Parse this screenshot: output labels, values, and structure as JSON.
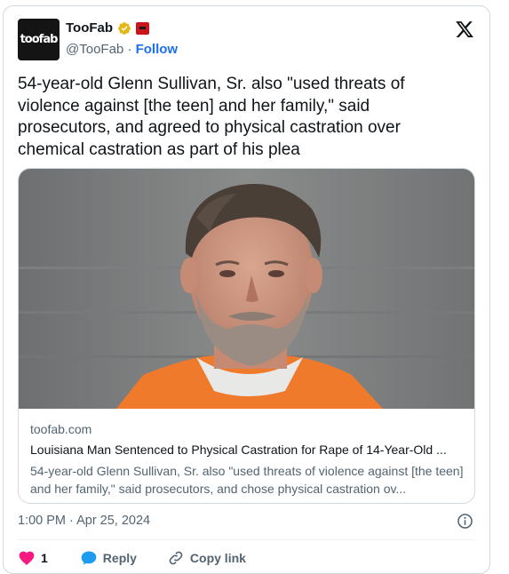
{
  "author": {
    "avatar_text": "toofab",
    "name": "TooFab",
    "handle": "@TooFab",
    "separator": "·",
    "follow_label": "Follow"
  },
  "tweet": {
    "text": "54-year-old Glenn Sullivan, Sr. also \"used threats of violence against [the teen] and her family,\" said prosecutors, and agreed to physical castration over chemical castration as part of his plea"
  },
  "link_card": {
    "domain": "toofab.com",
    "title": "Louisiana Man Sentenced to Physical Castration for Rape of 14-Year-Old ...",
    "description": "54-year-old Glenn Sullivan, Sr. also \"used threats of violence against [the teen] and her family,\" said prosecutors, and chose physical castration ov..."
  },
  "footer": {
    "timestamp": "1:00 PM · Apr 25, 2024",
    "like_count": "1",
    "reply_label": "Reply",
    "copy_link_label": "Copy link"
  },
  "colors": {
    "follow_blue": "#1d6ff2",
    "verified_gold": "#e2b719",
    "affiliate_red": "#c9161d",
    "like_pink": "#f91880",
    "reply_blue": "#1d9bf0"
  },
  "icons": [
    "verified-badge-icon",
    "affiliate-badge-icon",
    "x-logo-icon",
    "info-icon",
    "heart-icon",
    "reply-icon",
    "link-icon"
  ]
}
